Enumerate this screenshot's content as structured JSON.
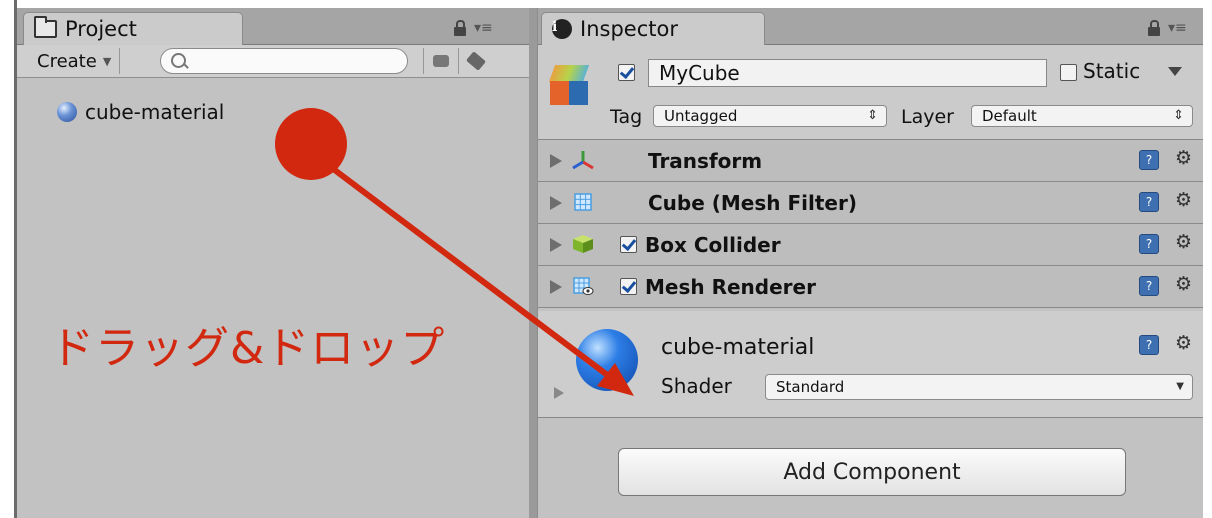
{
  "project": {
    "tab_label": "Project",
    "create_label": "Create",
    "search_placeholder": "",
    "items": [
      {
        "label": "cube-material"
      }
    ]
  },
  "inspector": {
    "tab_label": "Inspector",
    "object_name": "MyCube",
    "active": true,
    "static_label": "Static",
    "static_checked": false,
    "tag_label": "Tag",
    "tag_value": "Untagged",
    "layer_label": "Layer",
    "layer_value": "Default",
    "components": [
      {
        "name": "Transform",
        "has_checkbox": false,
        "icon": "transform-icon"
      },
      {
        "name": "Cube (Mesh Filter)",
        "has_checkbox": false,
        "icon": "mesh-filter-icon"
      },
      {
        "name": "Box Collider",
        "has_checkbox": true,
        "checked": true,
        "icon": "box-collider-icon"
      },
      {
        "name": "Mesh Renderer",
        "has_checkbox": true,
        "checked": true,
        "icon": "mesh-renderer-icon"
      }
    ],
    "material": {
      "name": "cube-material",
      "shader_label": "Shader",
      "shader_value": "Standard"
    },
    "add_component_label": "Add Component"
  },
  "annotation": {
    "text": "ドラッグ&ドロップ",
    "color": "#d1280f"
  }
}
